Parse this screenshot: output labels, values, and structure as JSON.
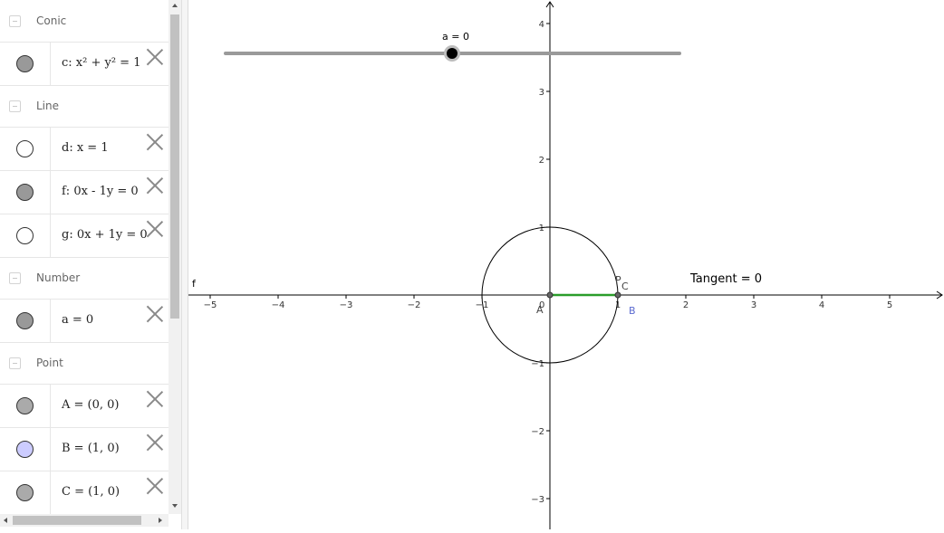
{
  "algebra": {
    "groups": [
      {
        "label": "Conic",
        "items": [
          {
            "expr": "c: x² + y² = 1",
            "marble": "#999999",
            "filled": true
          }
        ]
      },
      {
        "label": "Line",
        "items": [
          {
            "expr": "d: x = 1",
            "marble": "#ffffff",
            "filled": false
          },
          {
            "expr": "f: 0x - 1y = 0",
            "marble": "#999999",
            "filled": true
          },
          {
            "expr": "g: 0x + 1y = 0",
            "marble": "#ffffff",
            "filled": false
          }
        ]
      },
      {
        "label": "Number",
        "items": [
          {
            "expr": "a = 0",
            "marble": "#999999",
            "filled": true
          }
        ]
      },
      {
        "label": "Point",
        "items": [
          {
            "expr": "A = (0, 0)",
            "marble": "#aaaaaa",
            "filled": true
          },
          {
            "expr": "B = (1, 0)",
            "marble": "#ccccff",
            "filled": true
          },
          {
            "expr": "C = (1, 0)",
            "marble": "#aaaaaa",
            "filled": true
          }
        ]
      }
    ]
  },
  "graphics": {
    "slider": {
      "label": "a = 0",
      "value": 0,
      "min": -5,
      "max": 5
    },
    "x_ticks": [
      "−5",
      "−4",
      "−3",
      "−2",
      "−1",
      "0",
      "1",
      "2",
      "3",
      "4",
      "5"
    ],
    "y_ticks": [
      "−3",
      "−2",
      "−1",
      "1",
      "2",
      "3",
      "4"
    ],
    "labels": {
      "f": "f",
      "A": "A",
      "B": "B",
      "C": "C",
      "P": "P",
      "tangent": "Tangent = 0"
    },
    "colors": {
      "segment": "#2a9d2a",
      "point_B": "#5b6ad0",
      "axis": "#000000"
    }
  }
}
